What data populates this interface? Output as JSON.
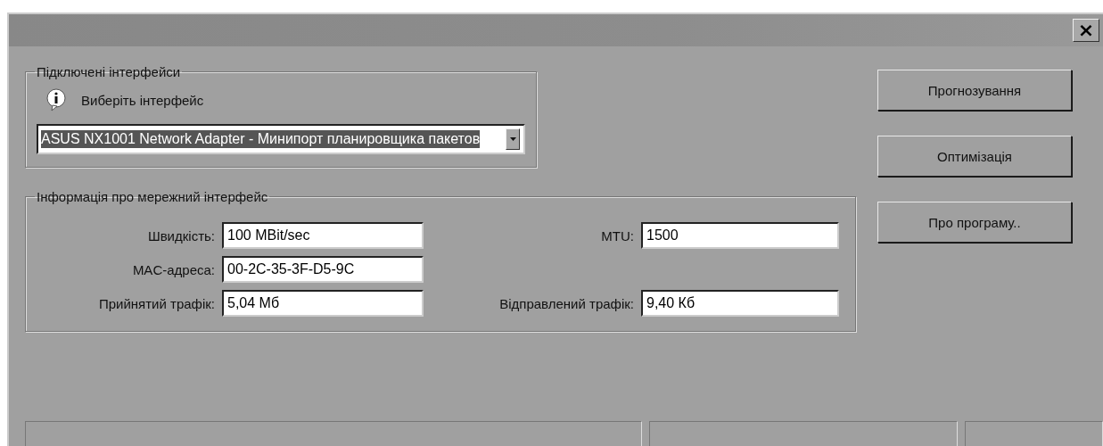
{
  "window": {
    "close": "×"
  },
  "connected_interfaces": {
    "title": "Підключені інтерфейси",
    "hint": "Виберіть інтерфейс",
    "selected_interface": "ASUS NX1001 Network Adapter - Минипорт планировщика пакетов"
  },
  "interface_info": {
    "title": "Інформація про мережний інтерфейс",
    "fields": [
      {
        "label": "Швидкість:",
        "value": "100 MBit/sec"
      },
      {
        "label": "MTU:",
        "value": "1500"
      },
      {
        "label": "MAC-адреса:",
        "value": "00-2C-35-3F-D5-9C"
      },
      {
        "label": "Прийнятий трафік:",
        "value": "5,04 Мб"
      },
      {
        "label": "Відправлений трафік:",
        "value": "9,40 Кб"
      }
    ]
  },
  "buttons": [
    "Прогнозування",
    "Оптимізація",
    "Про програму.."
  ]
}
